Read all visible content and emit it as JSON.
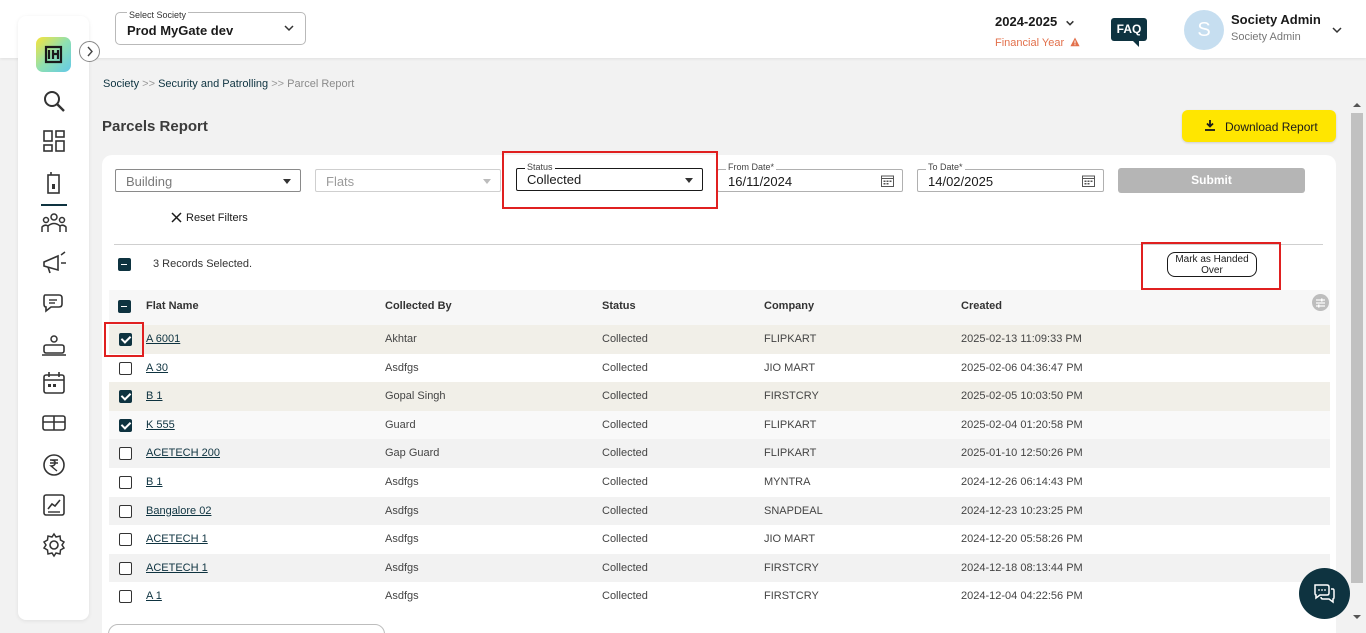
{
  "header": {
    "society_label": "Select Society",
    "society_value": "Prod MyGate dev",
    "year": "2024-2025",
    "year_sub": "Financial Year",
    "faq": "FAQ",
    "avatar_initial": "S",
    "user_name": "Society Admin",
    "user_role": "Society Admin"
  },
  "sidebar": {
    "items": [
      "search-icon",
      "dashboard-icon",
      "building-icon",
      "members-icon",
      "notice-icon",
      "chat-icon",
      "service-icon",
      "calendar-icon",
      "amenities-icon",
      "rupee-icon",
      "report-icon",
      "settings-icon"
    ],
    "active": "building-icon"
  },
  "breadcrumb": {
    "items": [
      "Society",
      "Security and Patrolling",
      "Parcel Report"
    ],
    "sep": ">>"
  },
  "page": {
    "title": "Parcels Report",
    "download_label": "Download Report"
  },
  "filters": {
    "building_placeholder": "Building",
    "flats_placeholder": "Flats",
    "status_label": "Status",
    "status_value": "Collected",
    "from_label": "From Date*",
    "from_value": "16/11/2024",
    "to_label": "To Date*",
    "to_value": "14/02/2025",
    "submit": "Submit",
    "reset": "Reset Filters"
  },
  "selection": {
    "count_text": "3 Records Selected.",
    "action_label": "Mark as Handed Over"
  },
  "table": {
    "columns": [
      "Flat Name",
      "Collected By",
      "Status",
      "Company",
      "Created"
    ],
    "rows": [
      {
        "flat": "A 6001",
        "by": "Akhtar",
        "status": "Collected",
        "company": "FLIPKART",
        "created": "2025-02-13 11:09:33 PM",
        "checked": true
      },
      {
        "flat": "A 30",
        "by": "Asdfgs",
        "status": "Collected",
        "company": "JIO MART",
        "created": "2025-02-06 04:36:47 PM",
        "checked": false
      },
      {
        "flat": "B 1",
        "by": "Gopal Singh",
        "status": "Collected",
        "company": "FIRSTCRY",
        "created": "2025-02-05 10:03:50 PM",
        "checked": true
      },
      {
        "flat": "K 555",
        "by": "Guard",
        "status": "Collected",
        "company": "FLIPKART",
        "created": "2025-02-04 01:20:58 PM",
        "checked": true
      },
      {
        "flat": "ACETECH 200",
        "by": "Gap Guard",
        "status": "Collected",
        "company": "FLIPKART",
        "created": "2025-01-10 12:50:26 PM",
        "checked": false
      },
      {
        "flat": "B 1",
        "by": "Asdfgs",
        "status": "Collected",
        "company": "MYNTRA",
        "created": "2024-12-26 06:14:43 PM",
        "checked": false
      },
      {
        "flat": "Bangalore 02",
        "by": "Asdfgs",
        "status": "Collected",
        "company": "SNAPDEAL",
        "created": "2024-12-23 10:23:25 PM",
        "checked": false
      },
      {
        "flat": "ACETECH 1",
        "by": "Asdfgs",
        "status": "Collected",
        "company": "JIO MART",
        "created": "2024-12-20 05:58:26 PM",
        "checked": false
      },
      {
        "flat": "ACETECH 1",
        "by": "Asdfgs",
        "status": "Collected",
        "company": "FIRSTCRY",
        "created": "2024-12-18 08:13:44 PM",
        "checked": false
      },
      {
        "flat": "A 1",
        "by": "Asdfgs",
        "status": "Collected",
        "company": "FIRSTCRY",
        "created": "2024-12-04 04:22:56 PM",
        "checked": false
      }
    ]
  },
  "colors": {
    "primary": "#0e3340",
    "accent_yellow": "#ffe600",
    "warning": "#e2704b",
    "highlight": "#e02020"
  }
}
